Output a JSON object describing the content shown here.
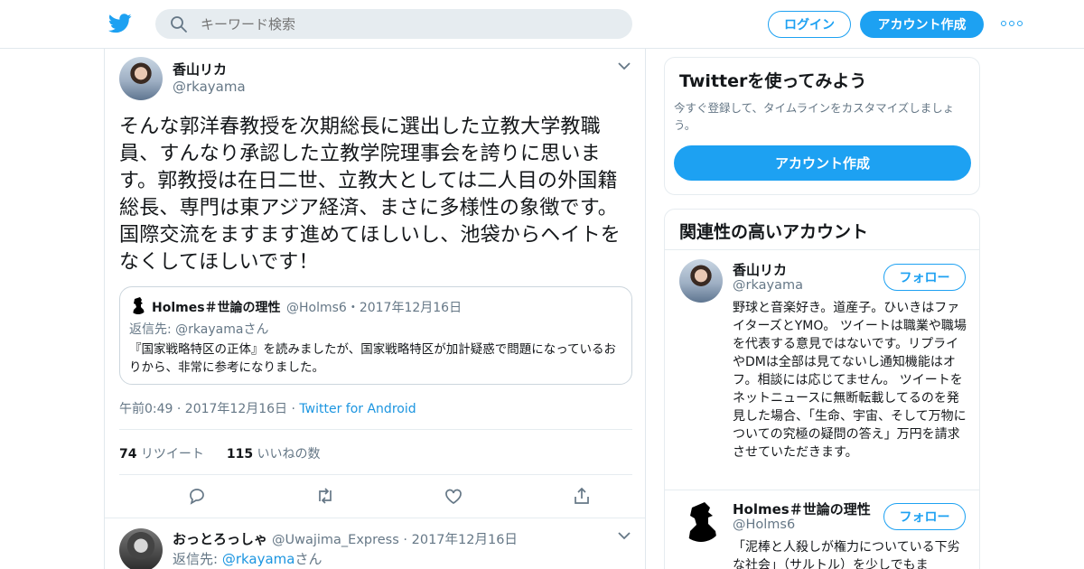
{
  "header": {
    "search_placeholder": "キーワード検索",
    "login_label": "ログイン",
    "signup_label": "アカウント作成"
  },
  "tweet": {
    "name": "香山リカ",
    "handle": "@rkayama",
    "text": "そんな郭洋春教授を次期総長に選出した立教大学教職員、すんなり承認した立教学院理事会を誇りに思います。郭教授は在日二世、立教大としては二人目の外国籍総長、専門は東アジア経済、まさに多様性の象徴です。国際交流をますます進めてほしいし、池袋からヘイトをなくしてほしいです！",
    "quote": {
      "name": "Holmes＃世論の理性",
      "handle_date": "@Holms6・2017年12月16日",
      "reply_to": "返信先: @rkayamaさん",
      "text": "『国家戦略特区の正体』を読みましたが、国家戦略特区が加計疑惑で問題になっているおりから、非常に参考になりました。"
    },
    "time": "午前0:49 · 2017年12月16日 · ",
    "source": "Twitter for Android",
    "retweets_count": "74",
    "retweets_label": " リツイート",
    "likes_count": "115",
    "likes_label": " いいねの数"
  },
  "reply": {
    "name": "おっとろっしゃ",
    "handle_date": "@Uwajima_Express · 2017年12月16日",
    "reply_prefix": "返信先: ",
    "reply_handle": "@rkayama",
    "reply_suffix": "さん"
  },
  "sidebar": {
    "signup_card": {
      "title": "Twitterを使ってみよう",
      "desc": "今すぐ登録して、タイムラインをカスタマイズしましょう。",
      "button": "アカウント作成"
    },
    "related": {
      "title": "関連性の高いアカウント",
      "follow_label": "フォロー",
      "accounts": [
        {
          "name": "香山リカ",
          "handle": "@rkayama",
          "bio": "野球と音楽好き。道産子。ひいきはファイターズとYMO。 ツイートは職業や職場を代表する意見ではないです。リプライやDMは全部は見てないし通知機能はオフ。相談には応じてません。 ツイートをネットニュースに無断転載してるのを発見した場合、「生命、宇宙、そして万物についての究極の疑問の答え」万円を請求させていただきます。"
        },
        {
          "name": "Holmes＃世論の理性",
          "handle": "@Holms6",
          "bio": "「泥棒と人殺しが権力についている下劣な社会」（サルトル）を少しでもま"
        }
      ]
    }
  },
  "colors": {
    "accent": "#1da1f2",
    "link": "#1b95e0",
    "muted": "#657786"
  }
}
